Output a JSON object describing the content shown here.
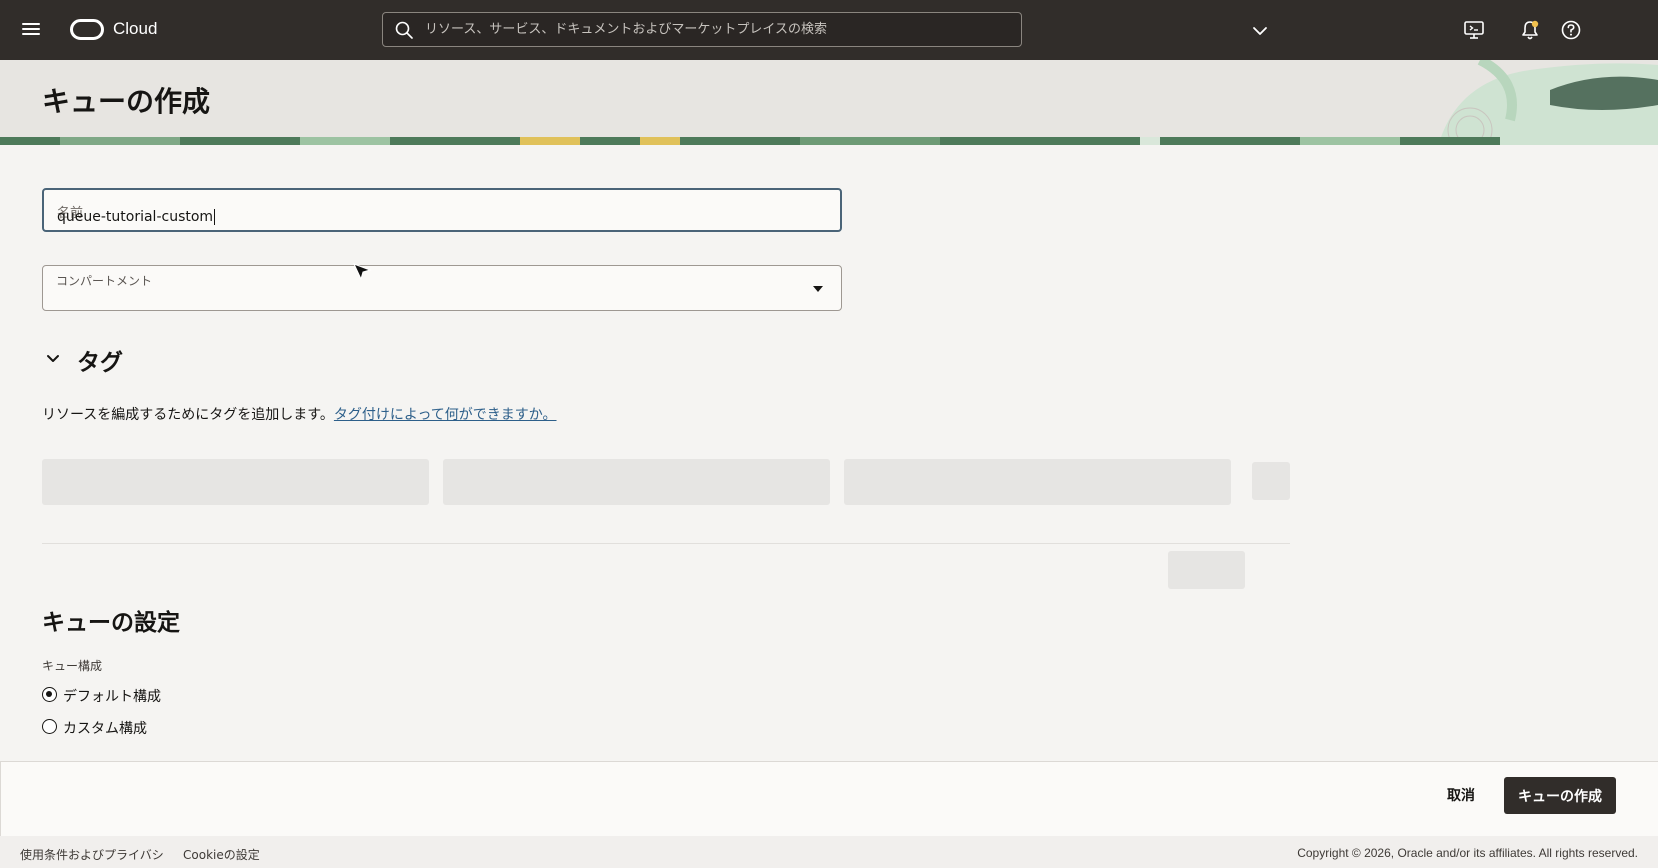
{
  "header": {
    "brand": "Cloud",
    "search_placeholder": "リソース、サービス、ドキュメントおよびマーケットプレイスの検索",
    "icons": [
      "hamburger-menu-icon",
      "oracle-logo",
      "search-icon",
      "chevron-down-icon",
      "cloud-shell-icon",
      "bell-icon",
      "help-icon"
    ]
  },
  "page": {
    "title": "キューの作成"
  },
  "form": {
    "name_label": "名前",
    "name_value": "queue-tutorial-custom",
    "compartment_label": "コンパートメント",
    "compartment_value": ""
  },
  "tags": {
    "heading": "タグ",
    "description": "リソースを編成するためにタグを追加します。",
    "link": "タグ付けによって何ができますか。"
  },
  "settings": {
    "heading": "キューの設定",
    "config_label": "キュー構成",
    "options": [
      {
        "label": "デフォルト構成",
        "selected": true
      },
      {
        "label": "カスタム構成",
        "selected": false
      }
    ]
  },
  "actions": {
    "cancel": "取消",
    "create": "キューの作成"
  },
  "footer": {
    "terms": "使用条件およびプライバシ",
    "cookie": "Cookieの設定",
    "copyright": "Copyright © 2026, Oracle and/or its affiliates. All rights reserved."
  },
  "colors": {
    "topbar": "#312d2a",
    "accent_link": "#2d5f8a",
    "primary_button": "#312d2a",
    "focus_border": "#4a6478"
  }
}
